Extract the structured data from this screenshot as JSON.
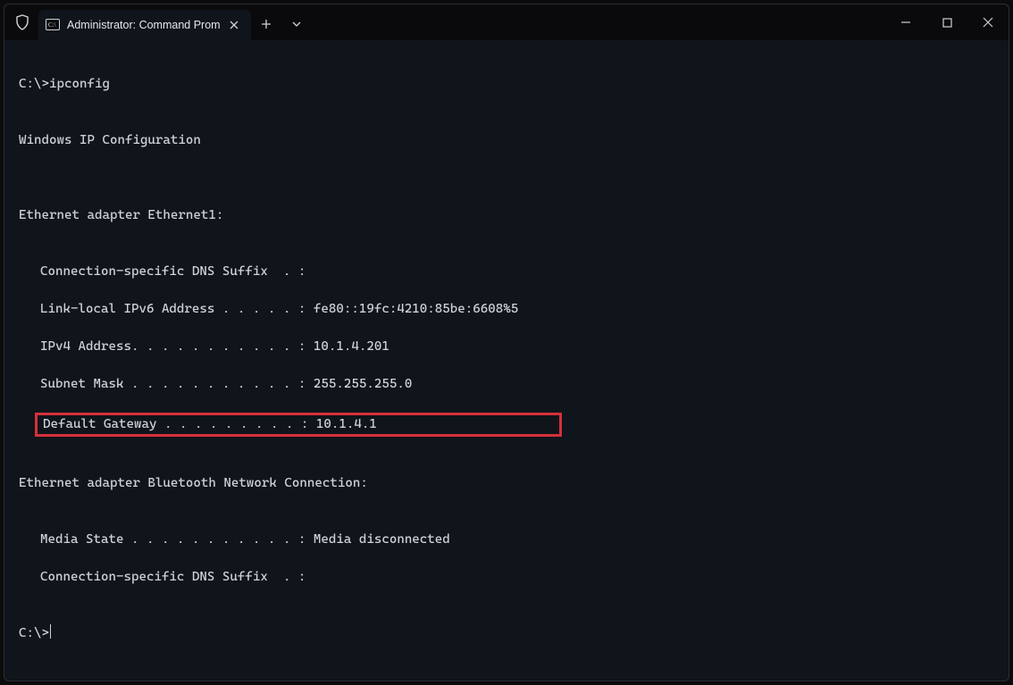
{
  "window": {
    "tab_title": "Administrator: Command Prom"
  },
  "terminal": {
    "prompt1": "C:\\>",
    "command1": "ipconfig",
    "blank": "",
    "header": "Windows IP Configuration",
    "adapter1_title": "Ethernet adapter Ethernet1:",
    "adapter1": {
      "dns_suffix": "Connection-specific DNS Suffix  . :",
      "ipv6": "Link-local IPv6 Address . . . . . : fe80::19fc:4210:85be:6608%5",
      "ipv4": "IPv4 Address. . . . . . . . . . . : 10.1.4.201",
      "subnet": "Subnet Mask . . . . . . . . . . . : 255.255.255.0",
      "gateway": "Default Gateway . . . . . . . . . : 10.1.4.1"
    },
    "adapter2_title": "Ethernet adapter Bluetooth Network Connection:",
    "adapter2": {
      "media_state": "Media State . . . . . . . . . . . : Media disconnected",
      "dns_suffix": "Connection-specific DNS Suffix  . :"
    },
    "prompt2": "C:\\>"
  }
}
